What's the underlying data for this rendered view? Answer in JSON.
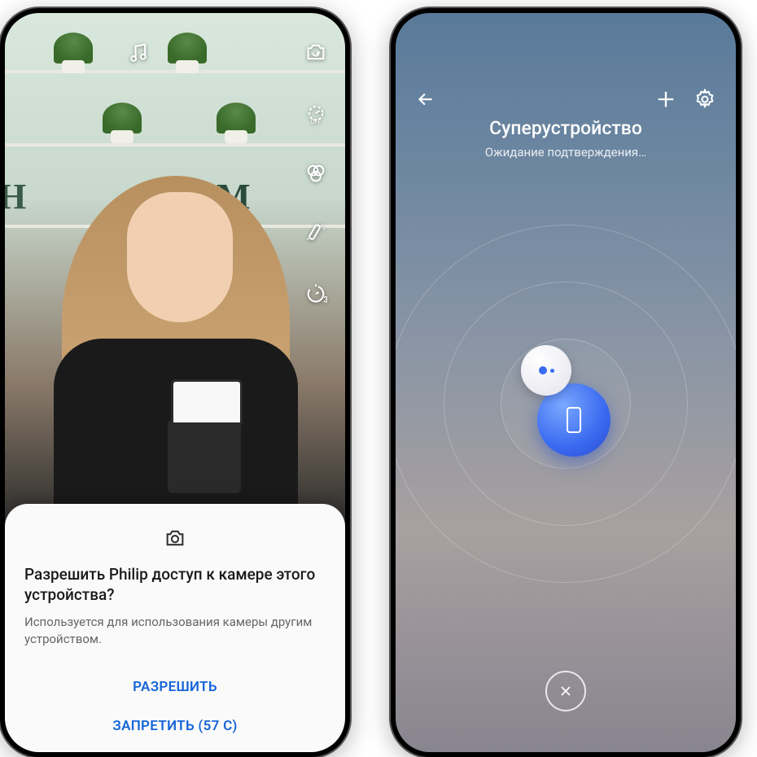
{
  "leftPhone": {
    "cameraControls": {
      "music": "music-icon",
      "switchCamera": "switch-camera-icon",
      "timerOff": "timer-off-icon",
      "filters": "filters-icon",
      "beauty": "magic-wand-icon",
      "countdown3": "countdown-3-icon"
    },
    "dialog": {
      "icon": "camera-icon",
      "title": "Разрешить Philip доступ к камере этого устройства?",
      "description": "Используется для использования камеры другим устройством.",
      "allowLabel": "РАЗРЕШИТЬ",
      "denyLabel": "ЗАПРЕТИТЬ (57 С)"
    }
  },
  "rightPhone": {
    "header": {
      "back": "back-icon",
      "add": "add-icon",
      "settings": "settings-icon"
    },
    "title": "Суперустройство",
    "subtitle": "Ожидание подтверждения…",
    "centerDevice": "phone-device-icon",
    "closeLabel": "close-icon"
  }
}
